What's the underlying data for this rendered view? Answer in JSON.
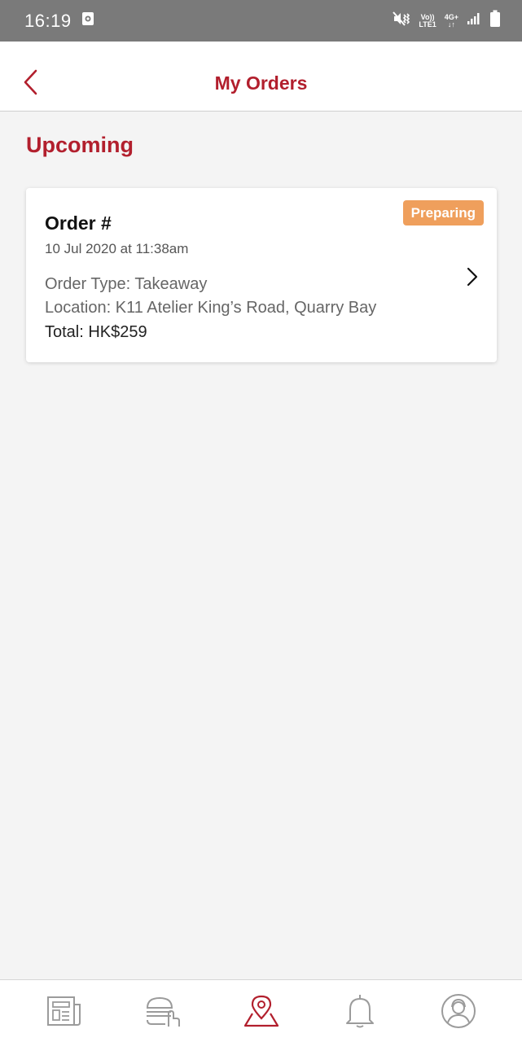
{
  "status_bar": {
    "time": "16:19",
    "network_top": "Vo))",
    "network_bottom": "LTE1",
    "network_type": "4G+",
    "icons": [
      "screen-record-icon",
      "mute-vibrate-icon",
      "signal-icon",
      "battery-icon"
    ]
  },
  "header": {
    "title": "My Orders",
    "back_icon": "chevron-left-icon"
  },
  "section": {
    "title": "Upcoming"
  },
  "orders": [
    {
      "title": "Order #",
      "date": "10 Jul 2020 at 11:38am",
      "type": "Order Type: Takeaway",
      "location": "Location: K11 Atelier King’s Road, Quarry Bay",
      "total": "Total: HK$259",
      "status": "Preparing"
    }
  ],
  "bottom_nav": {
    "items": [
      {
        "id": "news",
        "icon": "newspaper-icon",
        "active": false
      },
      {
        "id": "order",
        "icon": "burger-order-icon",
        "active": false
      },
      {
        "id": "locations",
        "icon": "location-pin-icon",
        "active": true
      },
      {
        "id": "notifications",
        "icon": "bell-icon",
        "active": false
      },
      {
        "id": "profile",
        "icon": "profile-icon",
        "active": false
      }
    ]
  },
  "colors": {
    "brand": "#b21f2d",
    "badge": "#ef9f5c",
    "status_bar": "#7a7a7a",
    "background": "#f4f4f4",
    "inactive_icon": "#9b9b9b"
  }
}
